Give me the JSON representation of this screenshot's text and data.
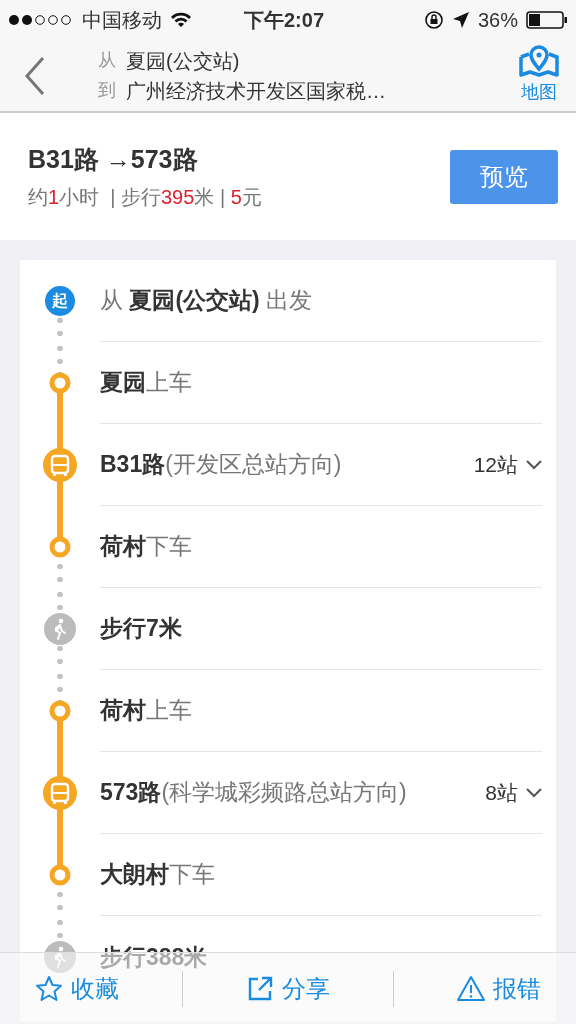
{
  "status_bar": {
    "carrier": "中国移动",
    "time": "下午2:07",
    "battery": "36%"
  },
  "header": {
    "from_label": "从",
    "from": "夏园(公交站)",
    "to_label": "到",
    "to": "广州经济技术开发区国家税…",
    "map_label": "地图"
  },
  "summary": {
    "title": "B31路 →573路",
    "meta": [
      {
        "text": "约",
        "highlight": false
      },
      {
        "text": "1",
        "highlight": true
      },
      {
        "text": "小时  | 步行",
        "highlight": false
      },
      {
        "text": "395",
        "highlight": true
      },
      {
        "text": "米 | ",
        "highlight": false
      },
      {
        "text": "5",
        "highlight": true
      },
      {
        "text": "元",
        "highlight": false
      }
    ],
    "preview_button": "预览"
  },
  "steps": [
    {
      "kind": "start",
      "icon_text": "起",
      "text": "从 **夏园(公交站)** 出发"
    },
    {
      "kind": "board",
      "text": "**夏园**上车"
    },
    {
      "kind": "bus",
      "text": "**B31路**(开发区总站方向)",
      "stops": "12站",
      "expanded": false
    },
    {
      "kind": "alight",
      "text": "**荷村**下车"
    },
    {
      "kind": "walk",
      "text": "**步行7米**"
    },
    {
      "kind": "board",
      "text": "**荷村**上车"
    },
    {
      "kind": "bus",
      "text": "**573路**(科学城彩频路总站方向)",
      "stops": "8站",
      "expanded": false
    },
    {
      "kind": "alight",
      "text": "**大朗村**下车"
    },
    {
      "kind": "walk",
      "text": "**步行388米**"
    }
  ],
  "toolbar": [
    {
      "kind": "favorite",
      "label": "收藏"
    },
    {
      "kind": "share",
      "label": "分享"
    },
    {
      "kind": "report",
      "label": "报错"
    }
  ]
}
